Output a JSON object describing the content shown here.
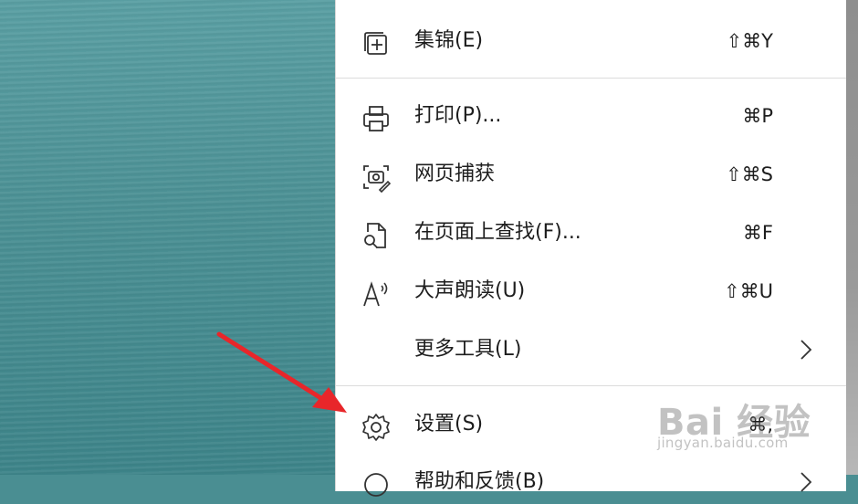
{
  "menu": {
    "items": [
      {
        "label": "集锦(E)",
        "shortcut": "⇧⌘Y",
        "icon": "collections-icon"
      },
      {
        "label": "打印(P)...",
        "shortcut": "⌘P",
        "icon": "print-icon"
      },
      {
        "label": "网页捕获",
        "shortcut": "⇧⌘S",
        "icon": "web-capture-icon"
      },
      {
        "label": "在页面上查找(F)...",
        "shortcut": "⌘F",
        "icon": "find-on-page-icon"
      },
      {
        "label": "大声朗读(U)",
        "shortcut": "⇧⌘U",
        "icon": "read-aloud-icon"
      },
      {
        "label": "更多工具(L)",
        "shortcut": "",
        "icon": "chevron-right-icon"
      },
      {
        "label": "设置(S)",
        "shortcut": "⌘,",
        "icon": "gear-icon"
      },
      {
        "label": "帮助和反馈(B)",
        "shortcut": "",
        "icon": "help-icon"
      }
    ]
  },
  "watermark": {
    "brand": "Bai 经验",
    "url": "jingyan.baidu.com"
  },
  "colors": {
    "menu_bg": "#ffffff",
    "text": "#1d1d1d",
    "arrow": "#e8262a",
    "background": "#4b9094"
  }
}
